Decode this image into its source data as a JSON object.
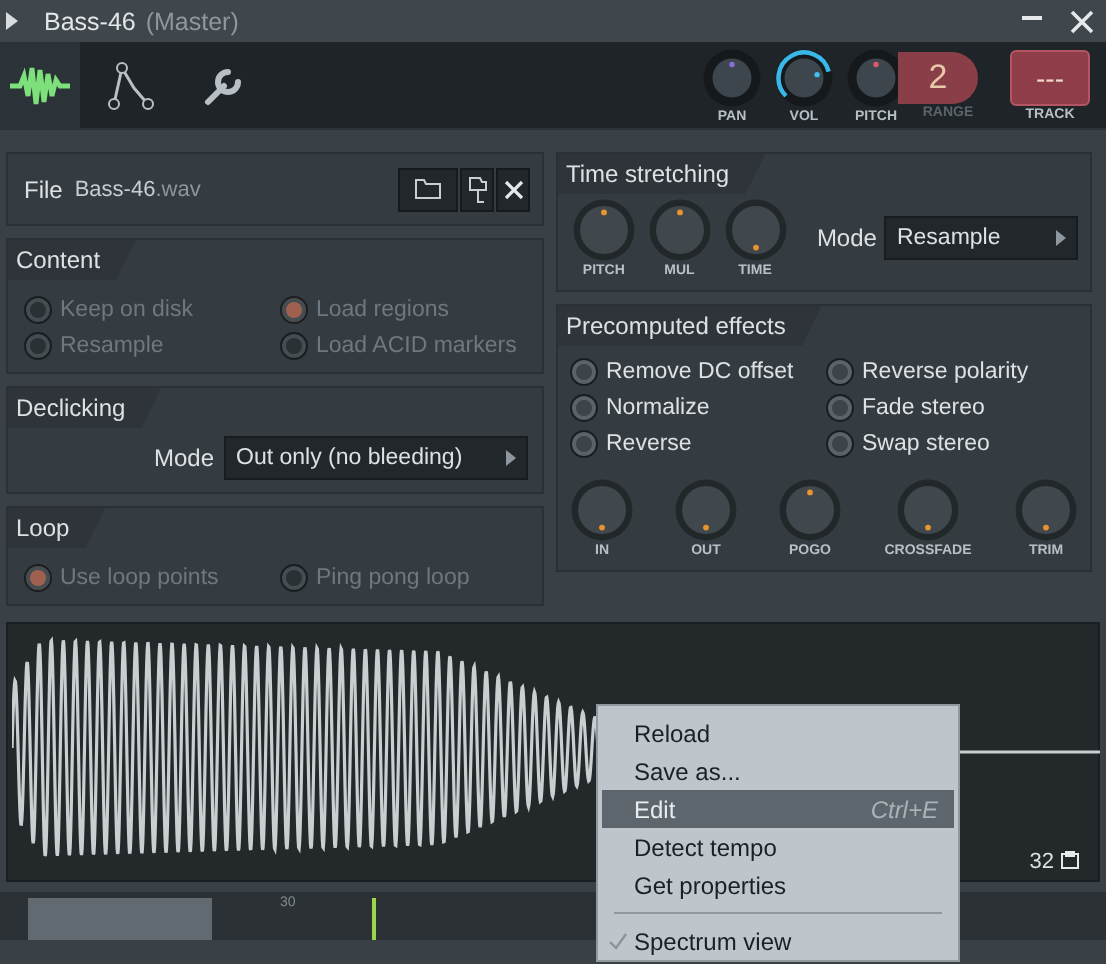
{
  "window": {
    "title": "Bass-46",
    "subtitle": "(Master)"
  },
  "toolbar": {
    "tabs": [
      {
        "kind": "wave",
        "selected": true
      },
      {
        "kind": "envelope",
        "selected": false
      },
      {
        "kind": "wrench",
        "selected": false
      }
    ],
    "knobs": [
      {
        "label": "PAN",
        "kind": "bipolar",
        "active": false
      },
      {
        "label": "VOL",
        "level": 0.78,
        "active": true
      },
      {
        "label": "PITCH",
        "kind": "bipolar",
        "active": false
      }
    ],
    "range": {
      "label": "RANGE",
      "value": "2"
    },
    "track": {
      "label": "TRACK",
      "value": "---"
    }
  },
  "file": {
    "label": "File",
    "name": "Bass-46",
    "ext": ".wav"
  },
  "content": {
    "title": "Content",
    "options": [
      {
        "label": "Keep on disk",
        "selected": false,
        "disabled": true
      },
      {
        "label": "Load regions",
        "selected": true,
        "disabled": true
      },
      {
        "label": "Resample",
        "selected": false,
        "disabled": true
      },
      {
        "label": "Load ACID markers",
        "selected": false,
        "disabled": true
      }
    ]
  },
  "declicking": {
    "title": "Declicking",
    "mode_label": "Mode",
    "mode": "Out only (no bleeding)"
  },
  "loop": {
    "title": "Loop",
    "options": [
      {
        "label": "Use loop points",
        "selected": true,
        "disabled": true
      },
      {
        "label": "Ping pong loop",
        "selected": false,
        "disabled": true
      }
    ]
  },
  "time_stretching": {
    "title": "Time stretching",
    "knobs": [
      {
        "label": "PITCH",
        "kind": "bipolar"
      },
      {
        "label": "MUL",
        "kind": "bipolar"
      },
      {
        "label": "TIME",
        "kind": "unipolar"
      }
    ],
    "mode_label": "Mode",
    "mode": "Resample"
  },
  "precomputed": {
    "title": "Precomputed effects",
    "options": [
      {
        "label": "Remove DC offset",
        "on": false
      },
      {
        "label": "Reverse polarity",
        "on": false
      },
      {
        "label": "Normalize",
        "on": false
      },
      {
        "label": "Fade stereo",
        "on": false
      },
      {
        "label": "Reverse",
        "on": false
      },
      {
        "label": "Swap stereo",
        "on": false
      }
    ],
    "knobs": [
      {
        "label": "IN",
        "kind": "unipolar"
      },
      {
        "label": "OUT",
        "kind": "unipolar"
      },
      {
        "label": "POGO",
        "kind": "bipolar"
      },
      {
        "label": "CROSSFADE",
        "kind": "unipolar"
      },
      {
        "label": "TRIM",
        "kind": "unipolar"
      }
    ]
  },
  "waveform": {
    "count": "32"
  },
  "timeline": {
    "marker": "30"
  },
  "context_menu": [
    {
      "kind": "item",
      "label": "Reload",
      "selected": false
    },
    {
      "kind": "item",
      "label": "Save as...",
      "selected": false
    },
    {
      "kind": "item",
      "label": "Edit",
      "shortcut": "Ctrl+E",
      "selected": true
    },
    {
      "kind": "item",
      "label": "Detect tempo",
      "selected": false
    },
    {
      "kind": "item",
      "label": "Get properties",
      "selected": false
    },
    {
      "kind": "separator"
    },
    {
      "kind": "item",
      "label": "Spectrum view",
      "checked": true,
      "selected": false
    }
  ]
}
